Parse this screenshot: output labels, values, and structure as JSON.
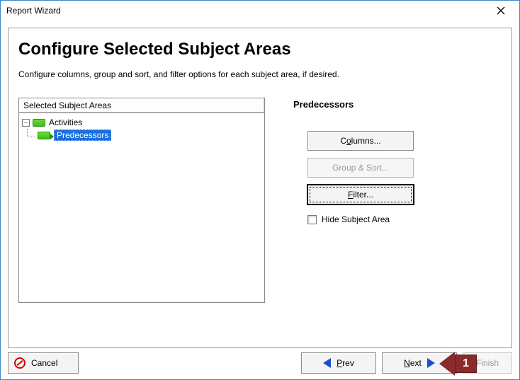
{
  "window": {
    "title": "Report Wizard"
  },
  "page": {
    "heading": "Configure Selected Subject Areas",
    "subtitle": "Configure columns, group and sort, and filter options for each subject area, if desired."
  },
  "tree": {
    "header": "Selected Subject Areas",
    "root": "Activities",
    "child_selected": "Predecessors"
  },
  "right": {
    "heading": "Predecessors",
    "columns_pre": "C",
    "columns_u": "o",
    "columns_post": "lumns...",
    "groupsort": "Group & Sort...",
    "filter_pre": "F",
    "filter_post": "ilter...",
    "hide_label": "Hide Subject Area",
    "hide_checked": false
  },
  "footer": {
    "cancel": "Cancel",
    "prev_pre": "P",
    "prev_post": "rev",
    "next_pre": "N",
    "next_post": "ext",
    "finish": "Finish"
  },
  "callout": {
    "label": "1"
  }
}
